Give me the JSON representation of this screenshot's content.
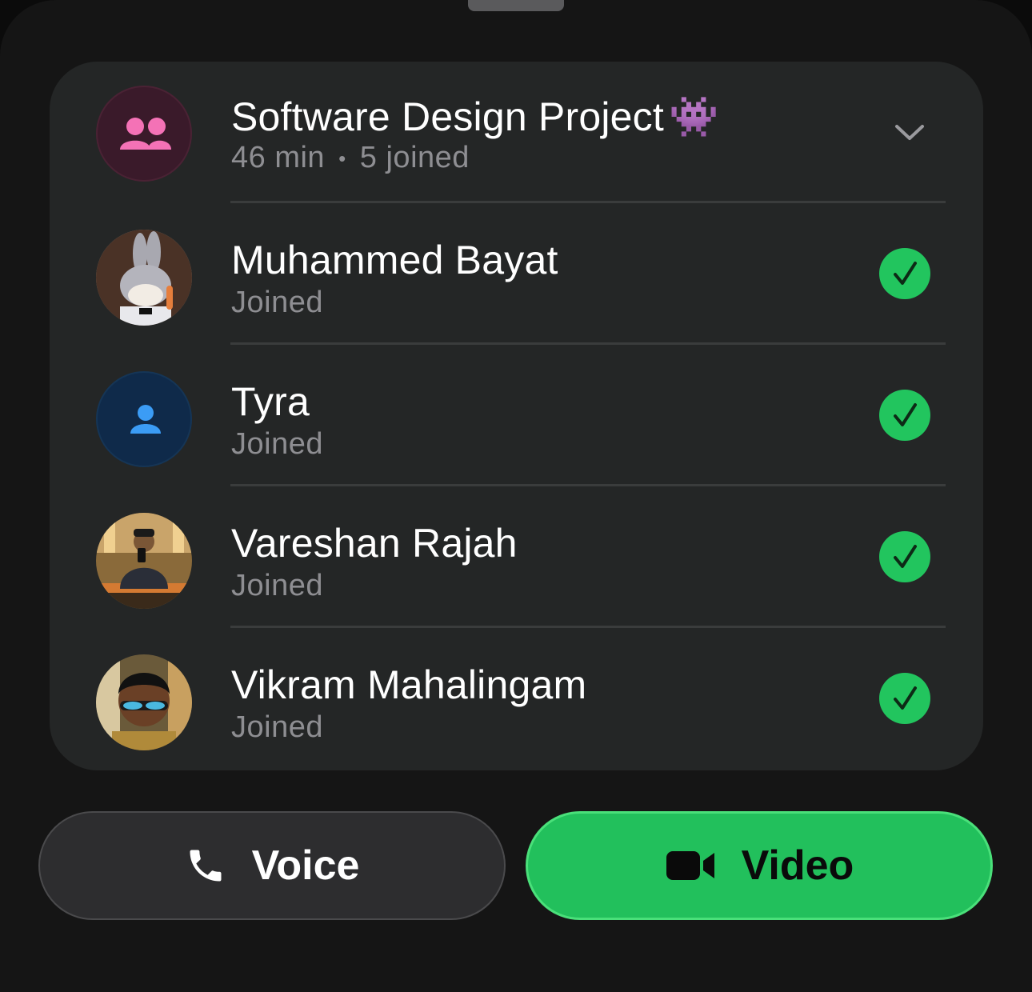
{
  "group": {
    "name": "Software Design Project",
    "emoji": "👾",
    "duration": "46 min",
    "separator": "•",
    "joined_count": "5 joined"
  },
  "participants": [
    {
      "name": "Muhammed Bayat",
      "status": "Joined"
    },
    {
      "name": "Tyra",
      "status": "Joined"
    },
    {
      "name": "Vareshan Rajah",
      "status": "Joined"
    },
    {
      "name": "Vikram Mahalingam",
      "status": "Joined"
    }
  ],
  "actions": {
    "voice_label": "Voice",
    "video_label": "Video"
  },
  "colors": {
    "accent_green": "#22c55e",
    "group_avatar_bg": "#3a1a2a",
    "group_icon": "#f472b6",
    "contact_avatar_bg": "#0f2a4a",
    "contact_icon": "#3b9cf5"
  }
}
